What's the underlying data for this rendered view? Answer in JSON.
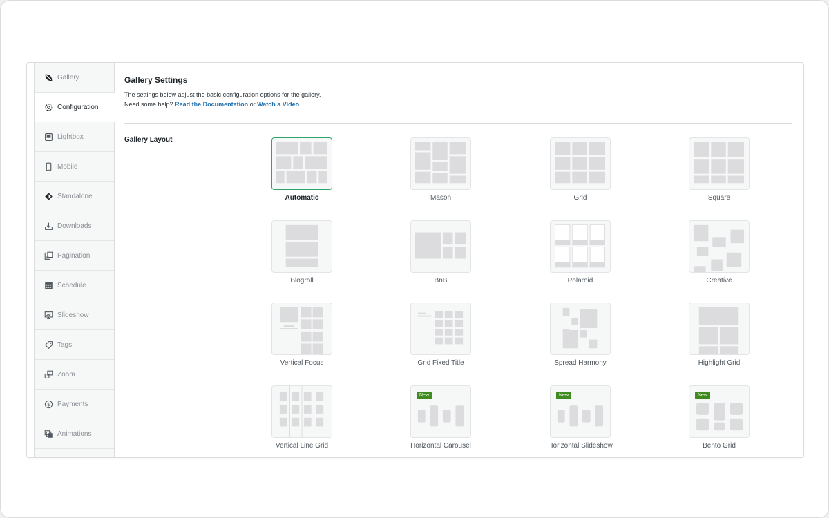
{
  "sidebar": {
    "items": [
      {
        "label": "Gallery",
        "icon": "leaf-icon"
      },
      {
        "label": "Configuration",
        "icon": "gear-icon"
      },
      {
        "label": "Lightbox",
        "icon": "lightbox-icon"
      },
      {
        "label": "Mobile",
        "icon": "mobile-icon"
      },
      {
        "label": "Standalone",
        "icon": "standalone-icon"
      },
      {
        "label": "Downloads",
        "icon": "download-icon"
      },
      {
        "label": "Pagination",
        "icon": "pagination-icon"
      },
      {
        "label": "Schedule",
        "icon": "calendar-icon"
      },
      {
        "label": "Slideshow",
        "icon": "slideshow-icon"
      },
      {
        "label": "Tags",
        "icon": "tag-icon"
      },
      {
        "label": "Zoom",
        "icon": "zoom-icon"
      },
      {
        "label": "Payments",
        "icon": "dollar-icon"
      },
      {
        "label": "Animations",
        "icon": "animation-icon"
      }
    ],
    "active_index": 1
  },
  "settings": {
    "title": "Gallery Settings",
    "desc_line1": "The settings below adjust the basic configuration options for the gallery.",
    "help_prefix": "Need some help?",
    "doc_link": "Read the Documentation",
    "or_text": "or",
    "video_link": "Watch a Video",
    "section_label": "Gallery Layout"
  },
  "layouts": [
    {
      "label": "Automatic",
      "selected": true
    },
    {
      "label": "Mason"
    },
    {
      "label": "Grid"
    },
    {
      "label": "Square"
    },
    {
      "label": "Blogroll"
    },
    {
      "label": "BnB"
    },
    {
      "label": "Polaroid"
    },
    {
      "label": "Creative"
    },
    {
      "label": "Vertical Focus"
    },
    {
      "label": "Grid Fixed Title"
    },
    {
      "label": "Spread Harmony"
    },
    {
      "label": "Highlight Grid"
    },
    {
      "label": "Vertical Line Grid"
    },
    {
      "label": "Horizontal Carousel",
      "badge": "New"
    },
    {
      "label": "Horizontal Slideshow",
      "badge": "New"
    },
    {
      "label": "Bento Grid",
      "badge": "New"
    }
  ],
  "colors": {
    "selected_border": "#2ea66b",
    "badge_bg": "#3f8b1f",
    "link": "#2271b1"
  }
}
